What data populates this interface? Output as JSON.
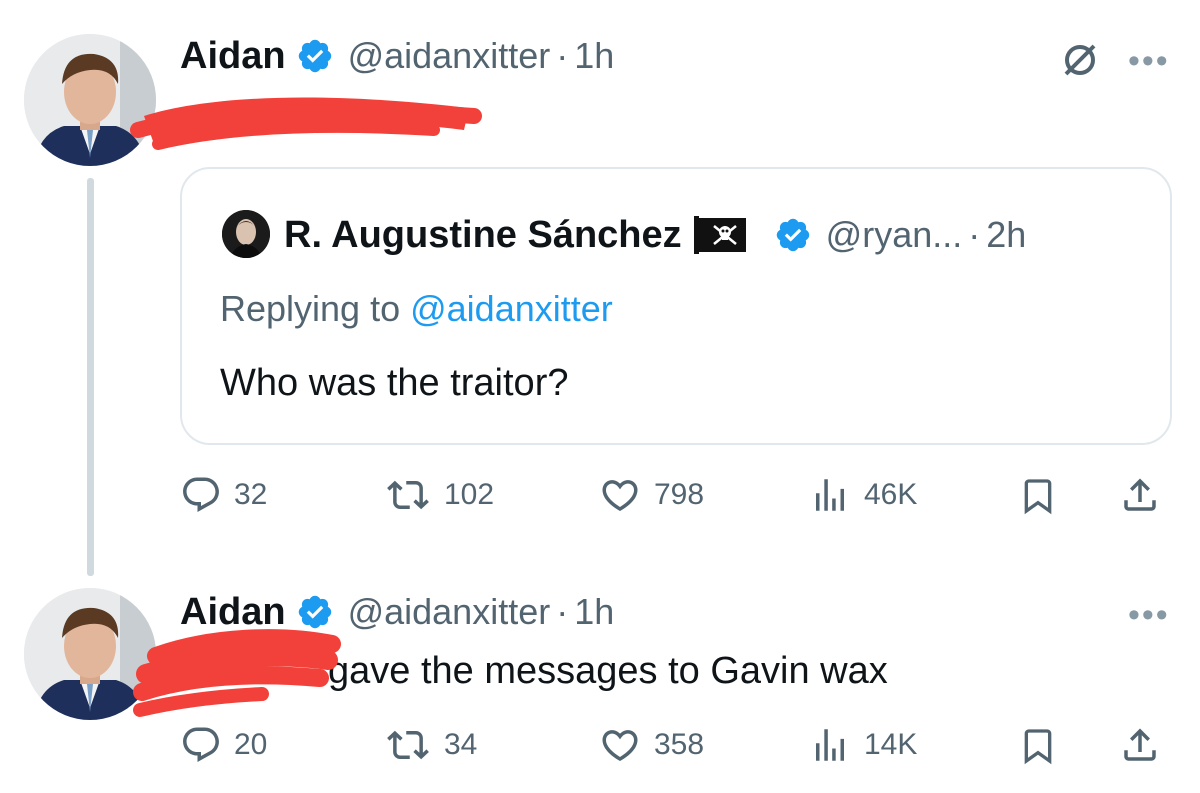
{
  "tweet1": {
    "name": "Aidan",
    "handle": "@aidanxitter",
    "sep": "·",
    "time": "1h",
    "quote": {
      "name": "R. Augustine Sánchez",
      "handle": "@ryan...",
      "sep": "·",
      "time": "2h",
      "replying_prefix": "Replying to ",
      "replying_handle": "@aidanxitter",
      "text": "Who was the traitor?"
    },
    "stats": {
      "replies": "32",
      "reposts": "102",
      "likes": "798",
      "views": "46K"
    }
  },
  "tweet2": {
    "name": "Aidan",
    "handle": "@aidanxitter",
    "sep": "·",
    "time": "1h",
    "text": "gave the messages to Gavin wax",
    "stats": {
      "replies": "20",
      "reposts": "34",
      "likes": "358",
      "views": "14K"
    }
  },
  "colors": {
    "verified": "#1d9bf0",
    "link": "#1d9bf0",
    "secondary_text": "#536471",
    "redaction": "#f2413a",
    "thread_line": "#cfd9de"
  },
  "icons": [
    "verified-badge-icon",
    "unfollow-slash-icon",
    "more-icon",
    "reply-icon",
    "repost-icon",
    "like-icon",
    "views-icon",
    "bookmark-icon",
    "share-icon",
    "pirate-flag-icon"
  ]
}
